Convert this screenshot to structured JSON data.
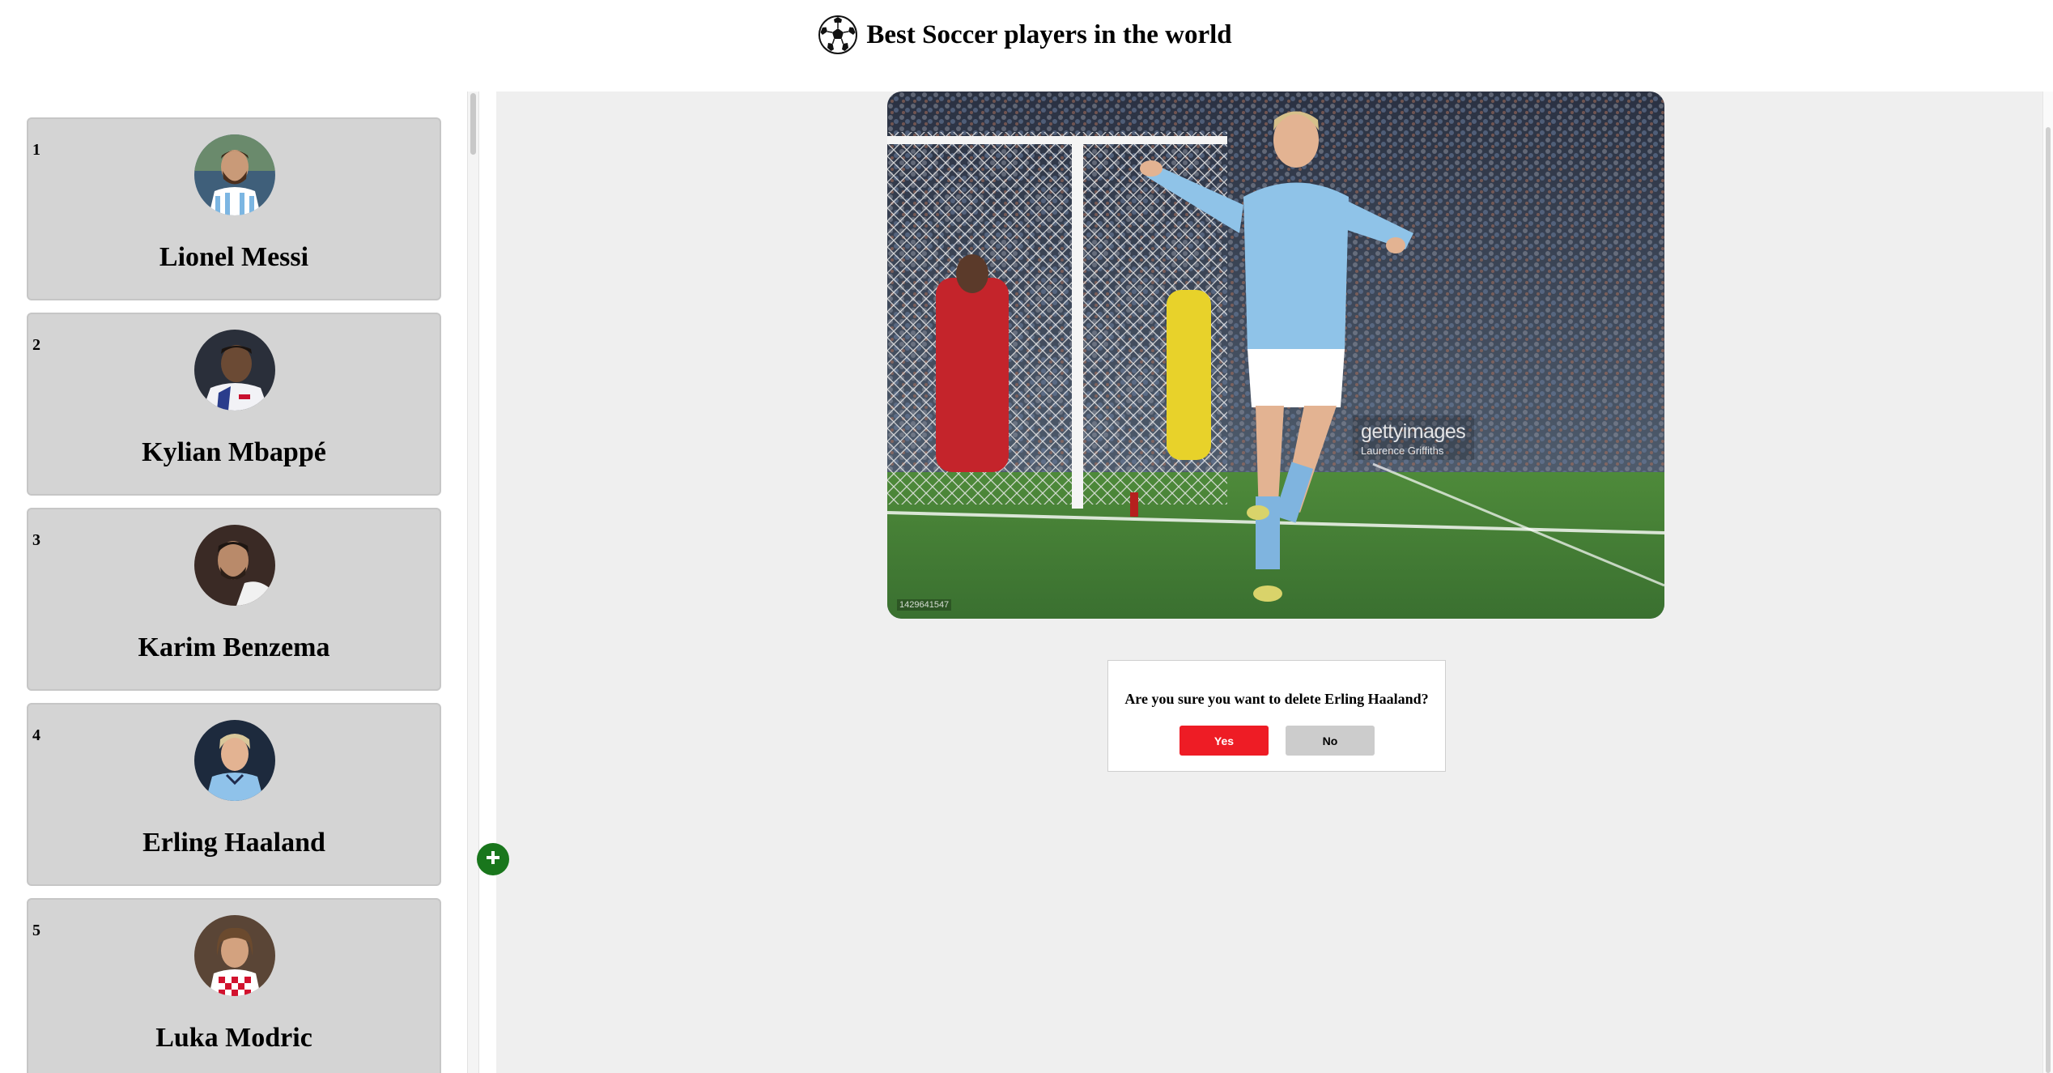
{
  "header": {
    "title": "Best Soccer players in the world",
    "icon": "soccer-ball-icon"
  },
  "players": [
    {
      "rank": "1",
      "name": "Lionel Messi"
    },
    {
      "rank": "2",
      "name": "Kylian Mbappé"
    },
    {
      "rank": "3",
      "name": "Karim Benzema"
    },
    {
      "rank": "4",
      "name": "Erling Haaland"
    },
    {
      "rank": "5",
      "name": "Luka Modric"
    }
  ],
  "photo": {
    "watermark_brand": "gettyimages",
    "watermark_credit": "Laurence Griffiths",
    "image_id": "1429641547"
  },
  "confirm": {
    "message": "Are you sure you want to delete Erling Haaland?",
    "yes_label": "Yes",
    "no_label": "No"
  },
  "colors": {
    "yes_button": "#ee1c25",
    "no_button": "#cccccc",
    "add_button": "#19761c",
    "card_background": "#d4d4d4",
    "main_background": "#efefef"
  }
}
